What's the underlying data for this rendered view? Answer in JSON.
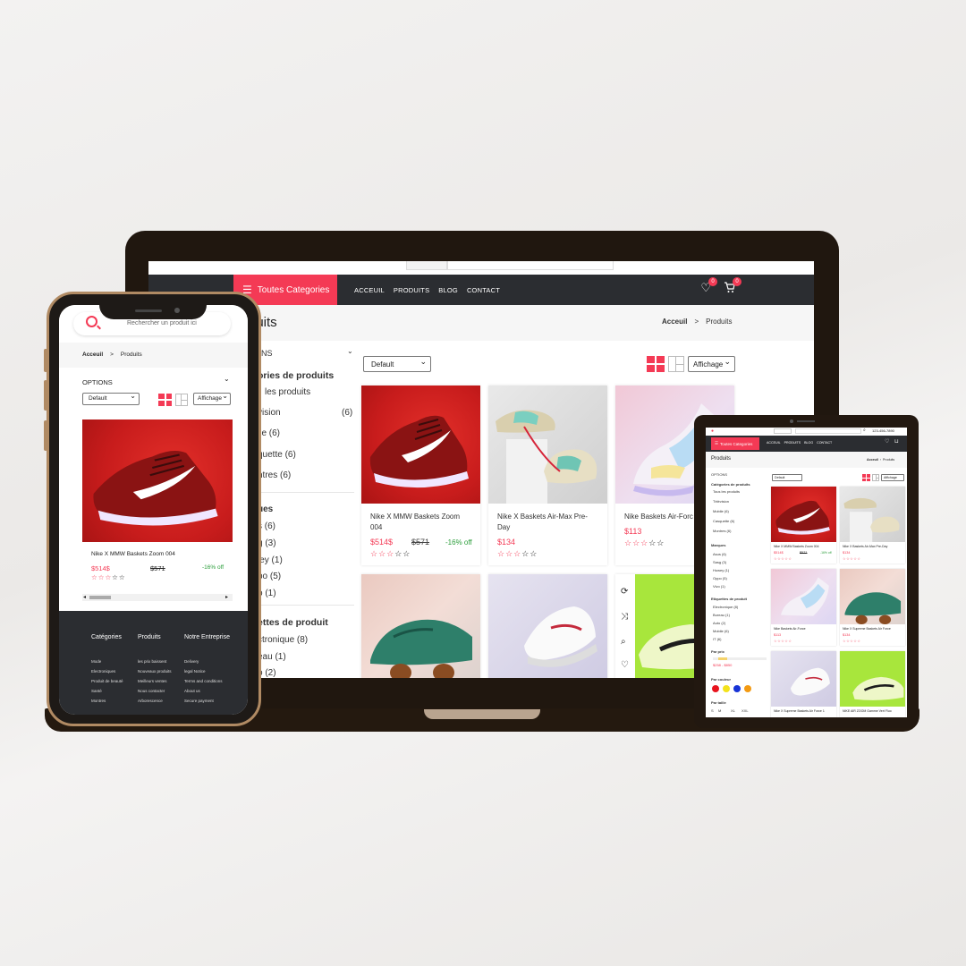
{
  "laptop": {
    "nav": {
      "categories_button": "Toutes Categories",
      "menu": [
        "ACCEUIL",
        "PRODUITS",
        "BLOG",
        "CONTACT"
      ],
      "wishlist_count": "0",
      "cart_count": "0"
    },
    "page_title": "duits",
    "breadcrumb": {
      "home": "Acceuil",
      "separator": ">",
      "current": "Produits"
    },
    "sidebar": {
      "options_label": "NS",
      "categories_title": "ories de produits",
      "categories": [
        {
          "label": "les produits",
          "count": ""
        },
        {
          "label": "vision",
          "count": "(6)"
        },
        {
          "label": "ile (6)",
          "count": ""
        },
        {
          "label": "quette (6)",
          "count": ""
        },
        {
          "label": "ntres (6)",
          "count": ""
        }
      ],
      "brands_title": "ues",
      "brands": [
        "s (6)",
        "g (3)",
        "ley (1)",
        "po (5)",
        "o (1)"
      ],
      "tags_title": "ettes de produit",
      "tags": [
        "ctronique (8)",
        "eau (1)",
        "o (2)"
      ]
    },
    "toolbar": {
      "sort_value": "Default",
      "display_label": "Affichage"
    },
    "products": [
      {
        "name": "Nike X MMW Baskets Zoom 004",
        "price": "$514$",
        "old_price": "$571",
        "discount": "-16% off",
        "stars": "☆☆☆☆☆"
      },
      {
        "name": "Nike X Baskets Air-Max Pre-Day",
        "price": "$134",
        "old_price": "",
        "discount": "",
        "stars": "☆☆☆☆☆"
      },
      {
        "name": "Nike Baskets Air-Forc",
        "price": "$113",
        "old_price": "",
        "discount": "",
        "stars": "☆☆☆☆☆"
      }
    ]
  },
  "phone": {
    "search_placeholder": "Rechercher un produit ici",
    "breadcrumb": {
      "home": "Acceuil",
      "separator": ">",
      "current": "Produits"
    },
    "options_label": "OPTIONS",
    "sort_value": "Default",
    "display_label": "Affichage",
    "product": {
      "name": "Nike X MMW Baskets Zoom 004",
      "price": "$514$",
      "old_price": "$571",
      "discount": "-16% off",
      "stars": "☆☆☆☆☆"
    },
    "footer": {
      "columns": [
        {
          "title": "Catégories",
          "items": [
            "Mode",
            "Electroniques",
            "Produit de beauté",
            "Santé",
            "Montres"
          ]
        },
        {
          "title": "Produits",
          "items": [
            "les prix baissent",
            "Nouveaux produits",
            "Meilleurs ventes",
            "Nous contacter",
            "Arborescence"
          ]
        },
        {
          "title": "Notre Entreprise",
          "items": [
            "Delivery",
            "legal Notice",
            "Terms and conditions",
            "About us",
            "Secure payment"
          ]
        }
      ]
    }
  },
  "tablet": {
    "top_phone": "123-456-7890",
    "nav": {
      "categories_button": "Toutes Categories",
      "menu": [
        "ACCEUIL",
        "PRODUITS",
        "BLOG",
        "CONTACT"
      ]
    },
    "page_title": "Produits",
    "breadcrumb": {
      "home": "Acceuil",
      "current": "Produits"
    },
    "sidebar": {
      "options_label": "OPTIONS",
      "categories_title": "Catégories de produits",
      "categories": [
        "Tous les produits",
        "Télévision",
        "Mobile (6)",
        "Casquette (6)",
        "Montres (6)"
      ],
      "brands_title": "Marques",
      "brands": [
        "Asus (6)",
        "Sasg (3)",
        "Huwey (1)",
        "Oppo (5)",
        "Vivo (1)"
      ],
      "tags_title": "Etiquettes de produit",
      "tags": [
        "Electronique (8)",
        "Bureau (1)",
        "Auto (2)",
        "Mobile (6)",
        "IT (6)"
      ],
      "price_title": "Par prix",
      "price_range": "$258 - $850",
      "color_title": "Par couleur",
      "colors": [
        "#e8141e",
        "#f3e21b",
        "#1733d6",
        "#f39a12"
      ],
      "size_title": "Par taille",
      "sizes": [
        "S",
        "M",
        "XL",
        "XXL"
      ]
    },
    "toolbar": {
      "sort_value": "Default",
      "display_label": "Affichage"
    },
    "products": [
      {
        "name": "Nike X MMW Baskets Zoom 004",
        "price": "$514$",
        "old_price": "$571",
        "discount": "-16% off"
      },
      {
        "name": "Nike X Baskets Air-Max Pre-Day",
        "price": "$134",
        "old_price": "",
        "discount": ""
      },
      {
        "name": "Nike Baskets Air-Force",
        "price": "$113",
        "old_price": "",
        "discount": ""
      },
      {
        "name": "Nike X Supreme Baskets Air Force",
        "price": "$134",
        "old_price": "",
        "discount": ""
      },
      {
        "name": "Nike X Supreme Baskets Air Force 1",
        "price": "",
        "old_price": "",
        "discount": ""
      },
      {
        "name": "NIKE AIR ZOOM Gamme Vert Fluo",
        "price": "",
        "old_price": "",
        "discount": ""
      }
    ]
  },
  "colors": {
    "accent": "#f43a55",
    "nav_dark": "#2b2d31",
    "device_frame": "#20170f",
    "phone_gold": "#b08a63"
  }
}
